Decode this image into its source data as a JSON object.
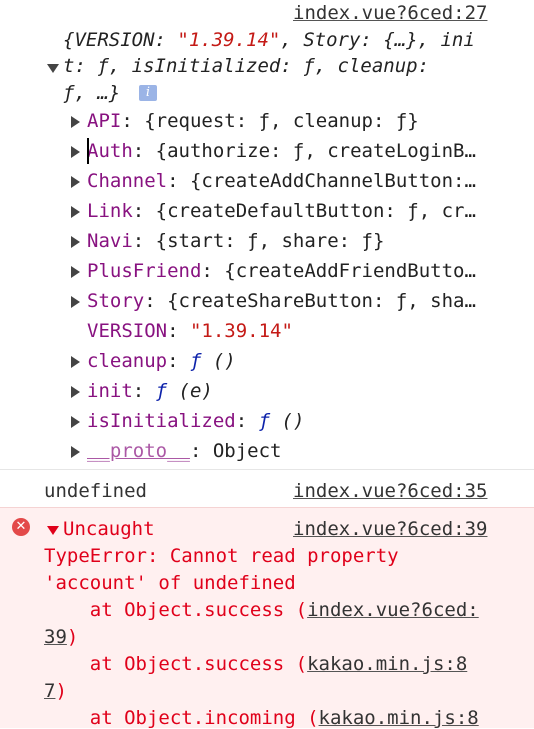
{
  "log_top": {
    "source_link": "index.vue?6ced:27",
    "summary_line1": "{VERSION: \"1.39.14\", Story: {…}, ini",
    "summary_line2": "t: ƒ, isInitialized: ƒ, cleanup:",
    "summary_line3": "ƒ, …}",
    "properties": [
      {
        "key": "API",
        "value": ": {request: ƒ, cleanup: ƒ}",
        "expandable": true
      },
      {
        "key": "Auth",
        "value": ": {authorize: ƒ, createLoginB…",
        "expandable": true
      },
      {
        "key": "Channel",
        "value": ": {createAddChannelButton:…",
        "expandable": true
      },
      {
        "key": "Link",
        "value": ": {createDefaultButton: ƒ, cr…",
        "expandable": true
      },
      {
        "key": "Navi",
        "value": ": {start: ƒ, share: ƒ}",
        "expandable": true
      },
      {
        "key": "PlusFriend",
        "value": ": {createAddFriendButto…",
        "expandable": true
      },
      {
        "key": "Story",
        "value": ": {createShareButton: ƒ, sha…",
        "expandable": true
      },
      {
        "key": "VERSION",
        "value": ": ",
        "string_value": "\"1.39.14\"",
        "expandable": false
      },
      {
        "key": "cleanup",
        "value": ": ",
        "fn_value": "ƒ ()",
        "expandable": true
      },
      {
        "key": "init",
        "value": ": ",
        "fn_value": "ƒ (e)",
        "expandable": true
      },
      {
        "key": "isInitialized",
        "value": ": ",
        "fn_value": "ƒ ()",
        "expandable": true
      },
      {
        "key": "__proto__",
        "value": ": Object",
        "expandable": true
      }
    ]
  },
  "log_undefined": {
    "text": "undefined",
    "source_link": "index.vue?6ced:35"
  },
  "error": {
    "label": "Uncaught",
    "source_link": "index.vue?6ced:39",
    "message1": "TypeError: Cannot read property",
    "message2": "'account' of undefined",
    "stack1_prefix": "    at Object.success (",
    "stack1_link_a": "index.vue?6ced:",
    "stack1_link_b": "39",
    "stack1_suffix": ")",
    "stack2_prefix": "    at Object.success (",
    "stack2_link_a": "kakao.min.js:8",
    "stack2_link_b": "7",
    "stack2_suffix": ")",
    "stack3_prefix": "    at Object.incoming (",
    "stack3_link_a": "kakao.min.js:8"
  },
  "colors": {
    "key": "#881280",
    "string": "#c41a16",
    "function": "#0d22aa",
    "error": "#e0001a",
    "error_bg": "#fff0f0"
  }
}
